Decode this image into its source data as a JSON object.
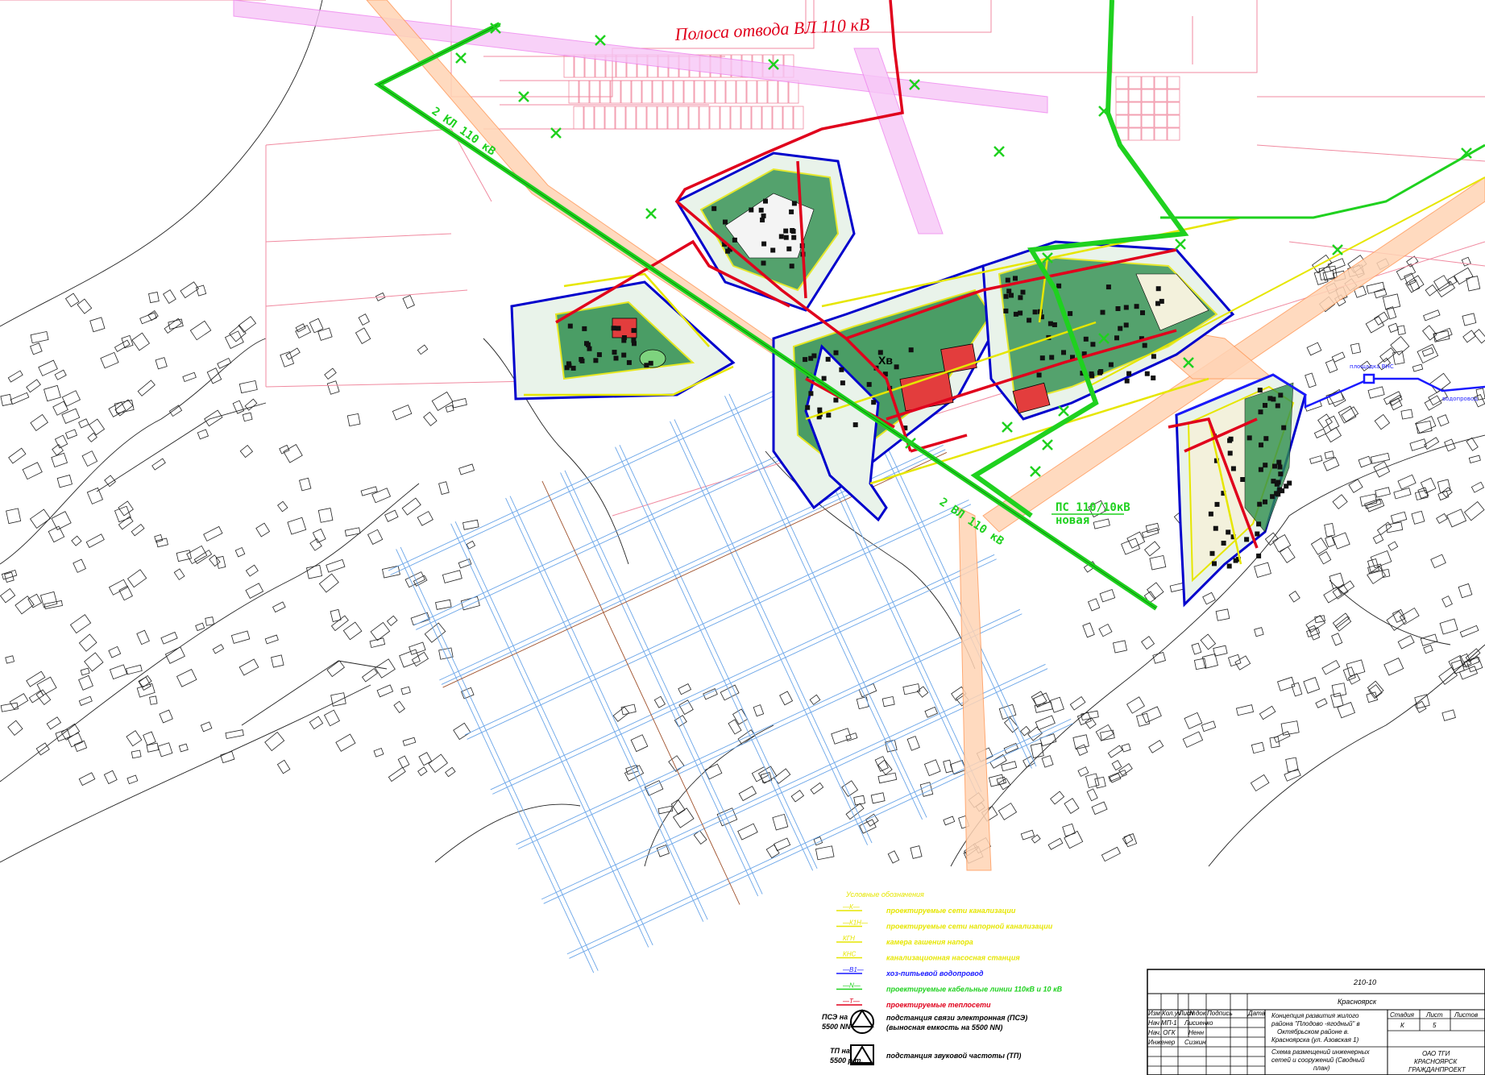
{
  "map_labels": {
    "vl_corridor": "Полоса отвода ВЛ 110 кВ",
    "kl_110_top": "2 КЛ 110 кВ",
    "vl_110_bottom": "2 ВЛ 110 кВ",
    "substation_line1": "ПС 110/10кВ",
    "substation_line2": "новая",
    "hv_marker": "Хв",
    "pump_station": "площадка ВНС",
    "water_pipe": "водопровод"
  },
  "legend": {
    "title": "Условные обозначения",
    "items": [
      {
        "code": "—К—",
        "text": "проектируемые сети канализации",
        "color": "#e6e600"
      },
      {
        "code": "—К1Н—",
        "text": "проектируемые сети напорной канализации",
        "color": "#e6e600"
      },
      {
        "code": "КГН",
        "text": "камера гашения напора",
        "color": "#e6e600"
      },
      {
        "code": "КНС",
        "text": "канализационная насосная станция",
        "color": "#e6e600"
      },
      {
        "code": "—В1—",
        "text": "хоз-питьевой водопровод",
        "color": "#1a1aff"
      },
      {
        "code": "—N—",
        "text": "проектируемые кабельные линии 110кВ и 10 кВ",
        "color": "#1fd11f"
      },
      {
        "code": "—Т—",
        "text": "проектируемые теплосети",
        "color": "#e0001c"
      }
    ],
    "symbols": [
      {
        "icon": "triangle-in-circle",
        "code_line1": "ПСЭ на",
        "code_line2": "5500 NN",
        "text_line1": "подстанция связи электронная (ПСЭ)",
        "text_line2": "(выносная емкость на 5500 NN)"
      },
      {
        "icon": "triangle-in-square",
        "code_line1": "ТП на",
        "code_line2": "5500 р.т.",
        "text_line1": "подстанция звуковой частоты (ТП)",
        "text_line2": ""
      }
    ]
  },
  "title_block": {
    "project_code": "210-10",
    "city": "Красноярск",
    "project_name": [
      "Концепция развития жилого",
      "района \"Плодово -ягодный\" в",
      "Октябрьском районе в.",
      "Красноярска (ул. Азовская 1)"
    ],
    "sheet_name": [
      "Схема размещений инженерных",
      "сетей и сооружений (Сводный",
      "план)"
    ],
    "header_cols": [
      "Изм",
      "Кол.уч",
      "Лист",
      "N док",
      "Подпись",
      "Дата"
    ],
    "roles": [
      {
        "role": "Нач МП-1",
        "name": "Лисиенко"
      },
      {
        "role": "Нач. ОГК",
        "name": "Ненн"
      },
      {
        "role": "Инженер",
        "name": "Сизкин"
      }
    ],
    "stage_header": "Стадия",
    "sheet_header": "Лист",
    "sheets_header": "Листов",
    "stage": "К",
    "sheet": "5",
    "company": [
      "ОАО ТГИ",
      "КРАСНОЯРСК",
      "ГРАЖДАНПРОЕКТ"
    ]
  },
  "colors": {
    "power_line": "#1fd11f",
    "heat": "#e0001c",
    "water": "#1a1aff",
    "sewer": "#e6e600",
    "corridor_pink": "#ee82ee",
    "corridor_orange": "#ff9a5a",
    "base": "#222222",
    "streets": "#f08aa0"
  }
}
